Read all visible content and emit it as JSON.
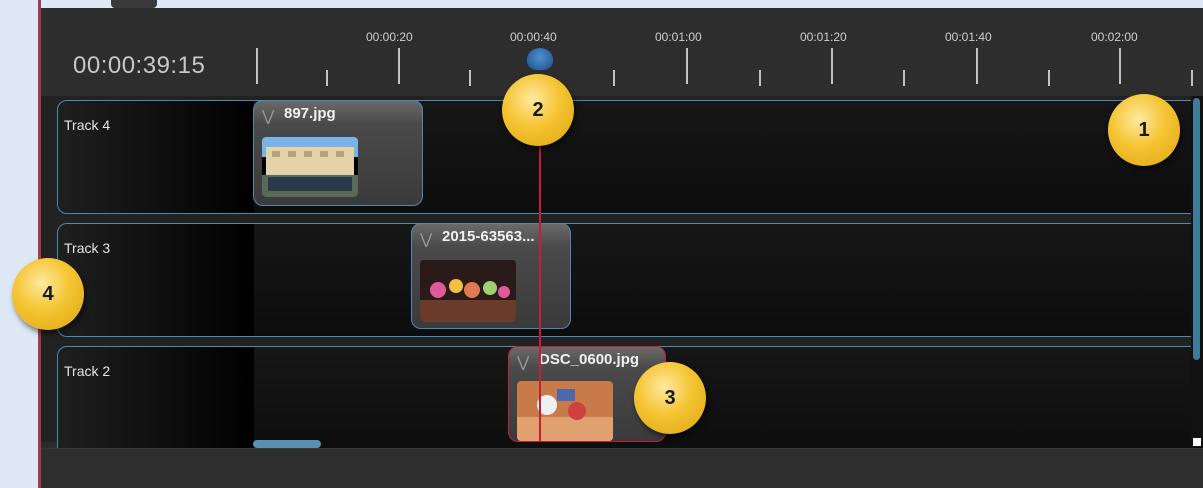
{
  "timeline": {
    "current_time": "00:00:39:15",
    "ruler_labels": [
      "00:00:20",
      "00:00:40",
      "00:01:00",
      "00:01:20",
      "00:01:40",
      "00:02:00"
    ]
  },
  "tracks": [
    {
      "label": "Track 4",
      "clip": {
        "name": "897.jpg"
      }
    },
    {
      "label": "Track 3",
      "clip": {
        "name": "2015-63563..."
      }
    },
    {
      "label": "Track 2",
      "clip": {
        "name": "DSC_0600.jpg"
      }
    }
  ],
  "callouts": [
    "1",
    "2",
    "3",
    "4"
  ],
  "colors": {
    "accent": "#4a8ab2",
    "playhead": "#c0203a",
    "badge": "#f5c431"
  }
}
